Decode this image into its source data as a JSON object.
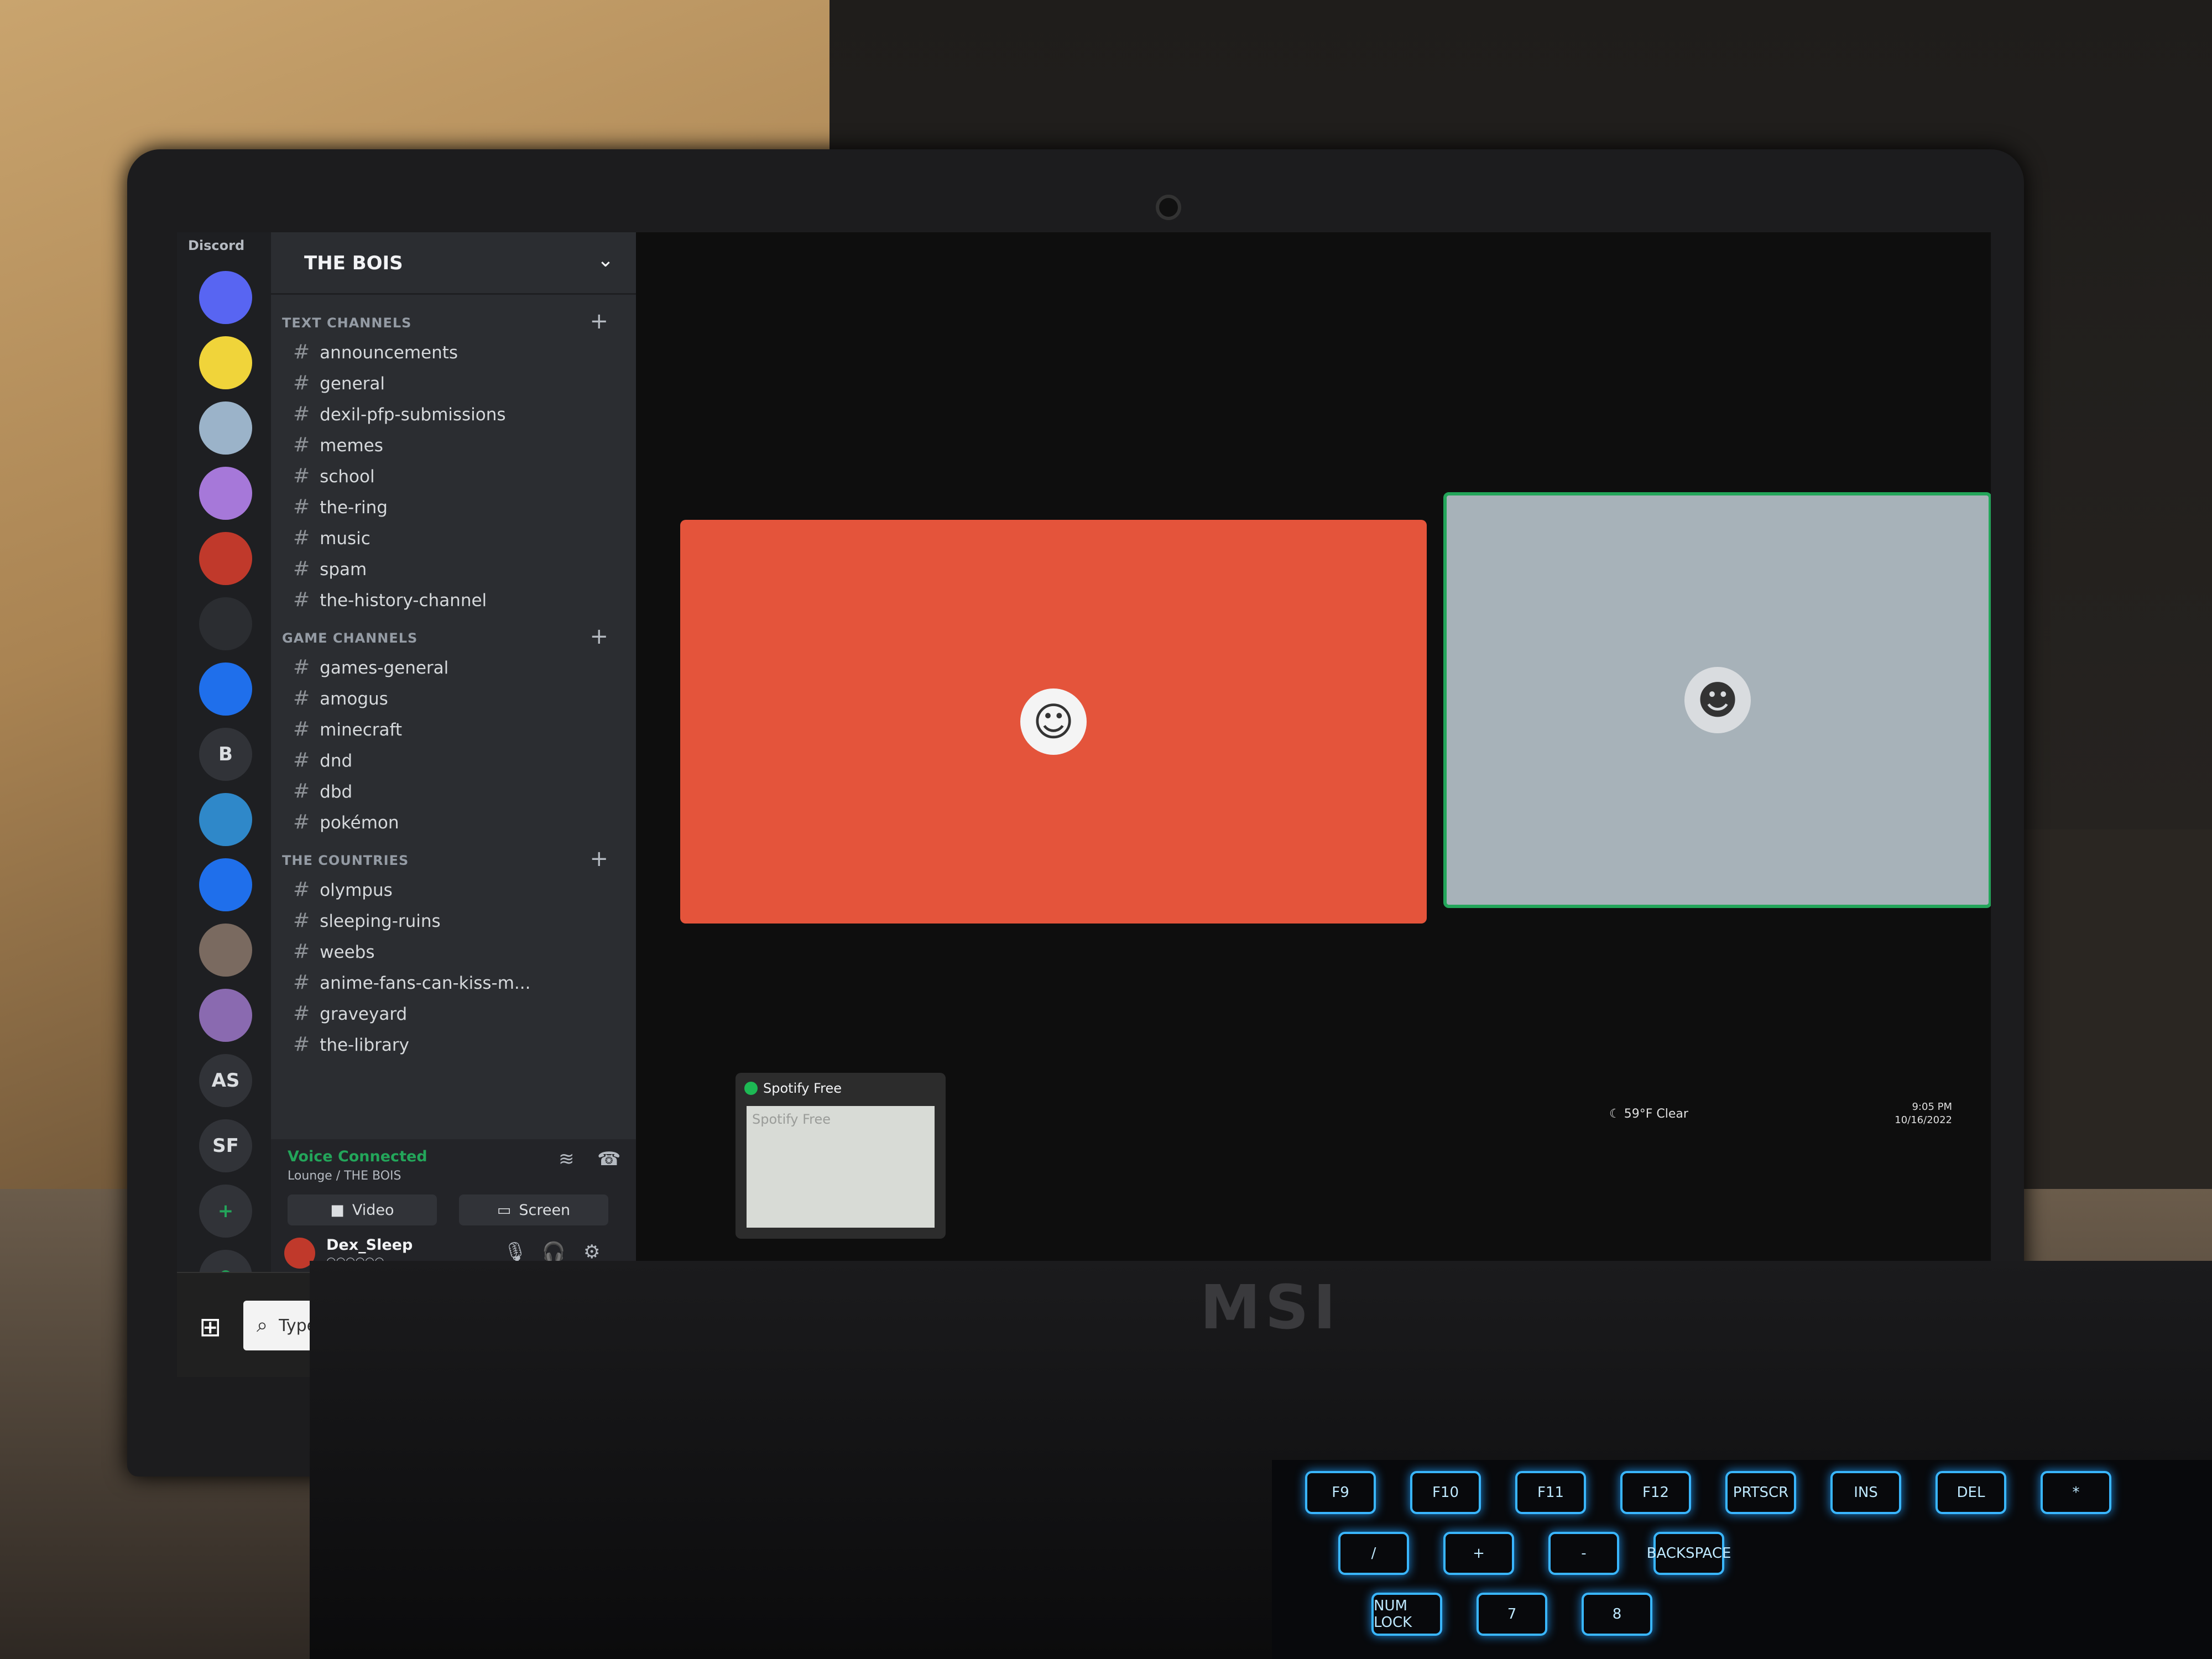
{
  "discord": {
    "app_title": "Discord",
    "server_name": "THE BOIS",
    "servers": [
      {
        "label": "",
        "color": "#5865f2",
        "icon": "discord-icon"
      },
      {
        "label": "",
        "color": "#f0d43a"
      },
      {
        "label": "",
        "color": "#9bb3c9"
      },
      {
        "label": "",
        "color": "#a678d9"
      },
      {
        "label": "",
        "color": "#c0392b"
      },
      {
        "label": "",
        "color": "#2b2d31",
        "icon": "fire-icon"
      },
      {
        "label": "",
        "color": "#1f6feb",
        "icon": "folder-icon"
      },
      {
        "label": "B",
        "color": "#313338"
      },
      {
        "label": "",
        "color": "#2f88c9"
      },
      {
        "label": "",
        "color": "#1f6feb",
        "icon": "folder-icon"
      },
      {
        "label": "",
        "color": "#7a6a60"
      },
      {
        "label": "",
        "color": "#8a6ab0"
      },
      {
        "label": "AS",
        "color": "#313338"
      },
      {
        "label": "SF",
        "color": "#313338"
      }
    ],
    "categories": [
      {
        "name": "TEXT CHANNELS",
        "channels": [
          "announcements",
          "general",
          "dexil-pfp-submissions",
          "memes",
          "school",
          "the-ring",
          "music",
          "spam",
          "the-history-channel"
        ]
      },
      {
        "name": "GAME CHANNELS",
        "channels": [
          "games-general",
          "amogus",
          "minecraft",
          "dnd",
          "dbd",
          "pokémon"
        ]
      },
      {
        "name": "THE COUNTRIES",
        "channels": [
          "olympus",
          "sleeping-ruins",
          "weebs",
          "anime-fans-can-kiss-m...",
          "graveyard",
          "the-library"
        ]
      }
    ],
    "voice": {
      "status": "Voice Connected",
      "location": "Lounge / THE BOIS",
      "video_label": "Video",
      "screen_label": "Screen"
    },
    "user": {
      "name": "Dex_Sleep",
      "status": "○○○○○○"
    }
  },
  "spotify_preview": {
    "title": "Spotify Free",
    "body_title": "Spotify Free"
  },
  "tray": {
    "weather": "59°F Clear",
    "time": "9:05 PM",
    "date": "10/16/2022"
  },
  "taskbar": {
    "search_placeholder": "Type here to search"
  },
  "laptop": {
    "brand": "MSI"
  },
  "keyboard_keys": [
    "F9",
    "F10",
    "F11",
    "F12",
    "PRTSCR",
    "INS",
    "DEL",
    "*",
    "/",
    "+",
    "-",
    "BACKSPACE",
    "NUM LOCK",
    "7",
    "8"
  ]
}
